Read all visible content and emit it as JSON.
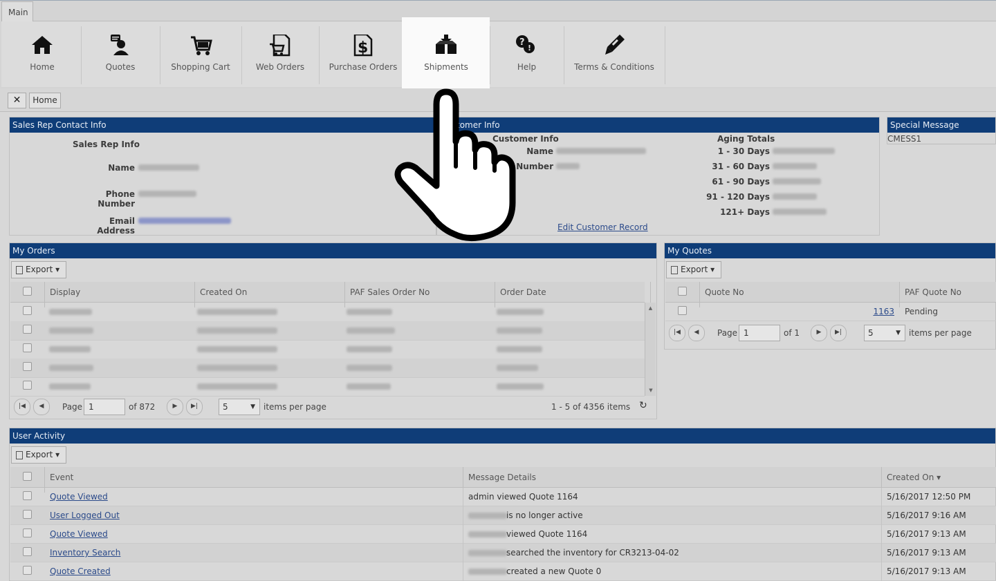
{
  "ribbon": {
    "main_tab": "Main",
    "items": [
      {
        "label": "Home",
        "icon": "home-icon"
      },
      {
        "label": "Quotes",
        "icon": "quotes-icon"
      },
      {
        "label": "Shopping Cart",
        "icon": "shopping-cart-icon"
      },
      {
        "label": "Web Orders",
        "icon": "web-orders-icon"
      },
      {
        "label": "Purchase Orders",
        "icon": "purchase-orders-icon"
      },
      {
        "label": "Shipments",
        "icon": "shipments-icon"
      },
      {
        "label": "Help",
        "icon": "help-icon"
      },
      {
        "label": "Terms & Conditions",
        "icon": "pen-icon"
      }
    ]
  },
  "tabstrip": {
    "close": "✕",
    "home": "Home"
  },
  "sales_rep": {
    "header": "Sales Rep Contact Info",
    "title": "Sales Rep Info",
    "name_label": "Name",
    "phone_label": "Phone Number",
    "email_label": "Email Address"
  },
  "customer": {
    "header": "tomer Info",
    "title": "Customer Info",
    "name_label": "Name",
    "number_label": "Number",
    "aging_title": "Aging Totals",
    "aging": [
      "1 - 30 Days",
      "31 - 60 Days",
      "61 - 90 Days",
      "91 - 120 Days",
      "121+ Days"
    ],
    "edit_link": "Edit Customer Record"
  },
  "special": {
    "header": "Special Message",
    "text": "CMESS1"
  },
  "orders": {
    "header": "My Orders",
    "export": "Export",
    "columns": [
      "Display",
      "Created On",
      "PAF Sales Order No",
      "Order Date"
    ],
    "pager": {
      "page_label": "Page",
      "page": "1",
      "of": "of 872",
      "size": "5",
      "per_page": "items per page",
      "summary": "1 - 5 of 4356 items"
    }
  },
  "quotes": {
    "header": "My Quotes",
    "export": "Export",
    "columns": [
      "Quote No",
      "PAF Quote No"
    ],
    "rows": [
      {
        "quote_no": "1163",
        "paf": "Pending"
      }
    ],
    "pager": {
      "page_label": "Page",
      "page": "1",
      "of": "of 1",
      "size": "5",
      "per_page": "items per page"
    }
  },
  "activity": {
    "header": "User Activity",
    "export": "Export",
    "columns": [
      "Event",
      "Message Details",
      "Created On ▾"
    ],
    "rows": [
      {
        "event": "Quote Viewed",
        "details": "admin viewed Quote 1164",
        "created": "5/16/2017 12:50 PM",
        "redacted": false
      },
      {
        "event": "User Logged Out",
        "details": "is no longer active",
        "created": "5/16/2017 9:16 AM",
        "redacted": true
      },
      {
        "event": "Quote Viewed",
        "details": "viewed Quote 1164",
        "created": "5/16/2017 9:13 AM",
        "redacted": true
      },
      {
        "event": "Inventory Search",
        "details": "searched the inventory for CR3213-04-02",
        "created": "5/16/2017 9:13 AM",
        "redacted": true
      },
      {
        "event": "Quote Created",
        "details": "created a new Quote 0",
        "created": "5/16/2017 9:13 AM",
        "redacted": true
      }
    ]
  }
}
